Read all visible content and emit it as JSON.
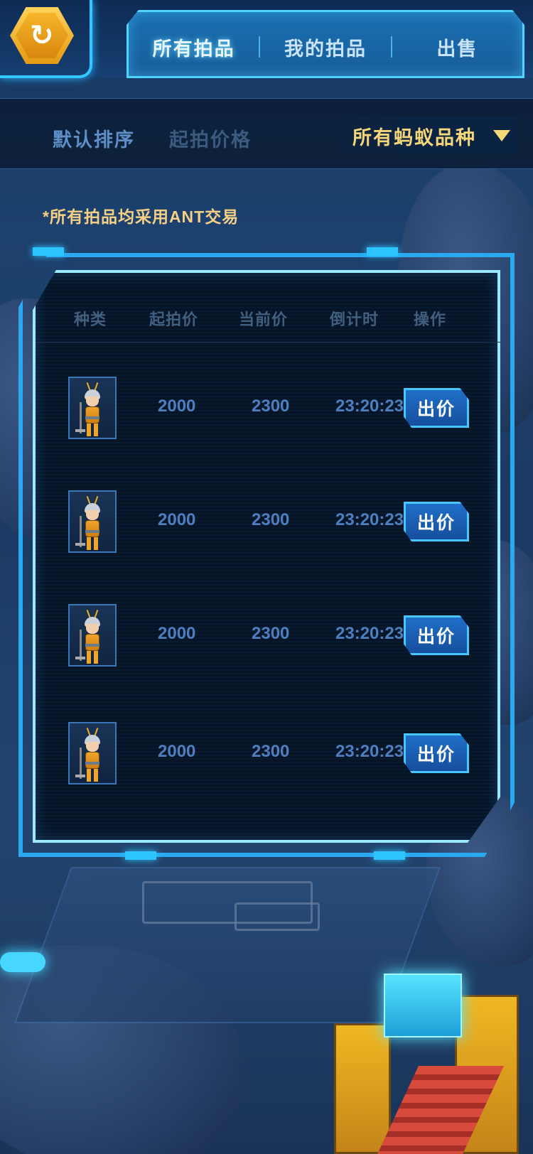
{
  "tabs": [
    {
      "label": "所有拍品"
    },
    {
      "label": "我的拍品"
    },
    {
      "label": "出售"
    }
  ],
  "sort": {
    "default_label": "默认排序",
    "price_label": "起拍价格",
    "filter_label": "所有蚂蚁品种"
  },
  "notice": "*所有拍品均采用ANT交易",
  "table": {
    "headers": [
      "种类",
      "起拍价",
      "当前价",
      "倒计时",
      "操作"
    ],
    "rows": [
      {
        "start_price": "2000",
        "current_price": "2300",
        "countdown": "23:20:23",
        "action": "出价"
      },
      {
        "start_price": "2000",
        "current_price": "2300",
        "countdown": "23:20:23",
        "action": "出价"
      },
      {
        "start_price": "2000",
        "current_price": "2300",
        "countdown": "23:20:23",
        "action": "出价"
      },
      {
        "start_price": "2000",
        "current_price": "2300",
        "countdown": "23:20:23",
        "action": "出价"
      }
    ]
  },
  "icons": {
    "back": "back-arrow-icon",
    "filter_caret": "caret-down-icon",
    "item_thumb": "ant-miner-avatar"
  },
  "colors": {
    "accent_cyan": "#2aa8f0",
    "filter_gold": "#f5d77a",
    "notice_text": "#f4cf85",
    "back_button": "#e59a12"
  }
}
